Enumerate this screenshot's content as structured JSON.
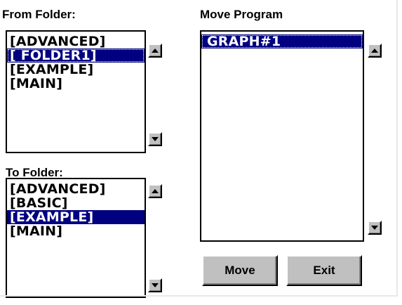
{
  "from_folder": {
    "label": "From Folder:",
    "items": [
      "[ADVANCED]",
      "[ FOLDER1]",
      "[EXAMPLE]",
      "[MAIN]"
    ],
    "selected_index": 1
  },
  "to_folder": {
    "label": "To Folder:",
    "items": [
      "[ADVANCED]",
      "[BASIC]",
      "[EXAMPLE]",
      "[MAIN]"
    ],
    "selected_index": 2
  },
  "move_program": {
    "label": "Move Program",
    "items": [
      "GRAPH#1"
    ],
    "selected_index": 0
  },
  "buttons": {
    "move_label": "Move",
    "exit_label": "Exit"
  },
  "icons": {
    "scroll_up": "triangle-up-icon",
    "scroll_down": "triangle-down-icon"
  },
  "colors": {
    "selection": "#000080",
    "button_face": "#c0c0c0"
  }
}
